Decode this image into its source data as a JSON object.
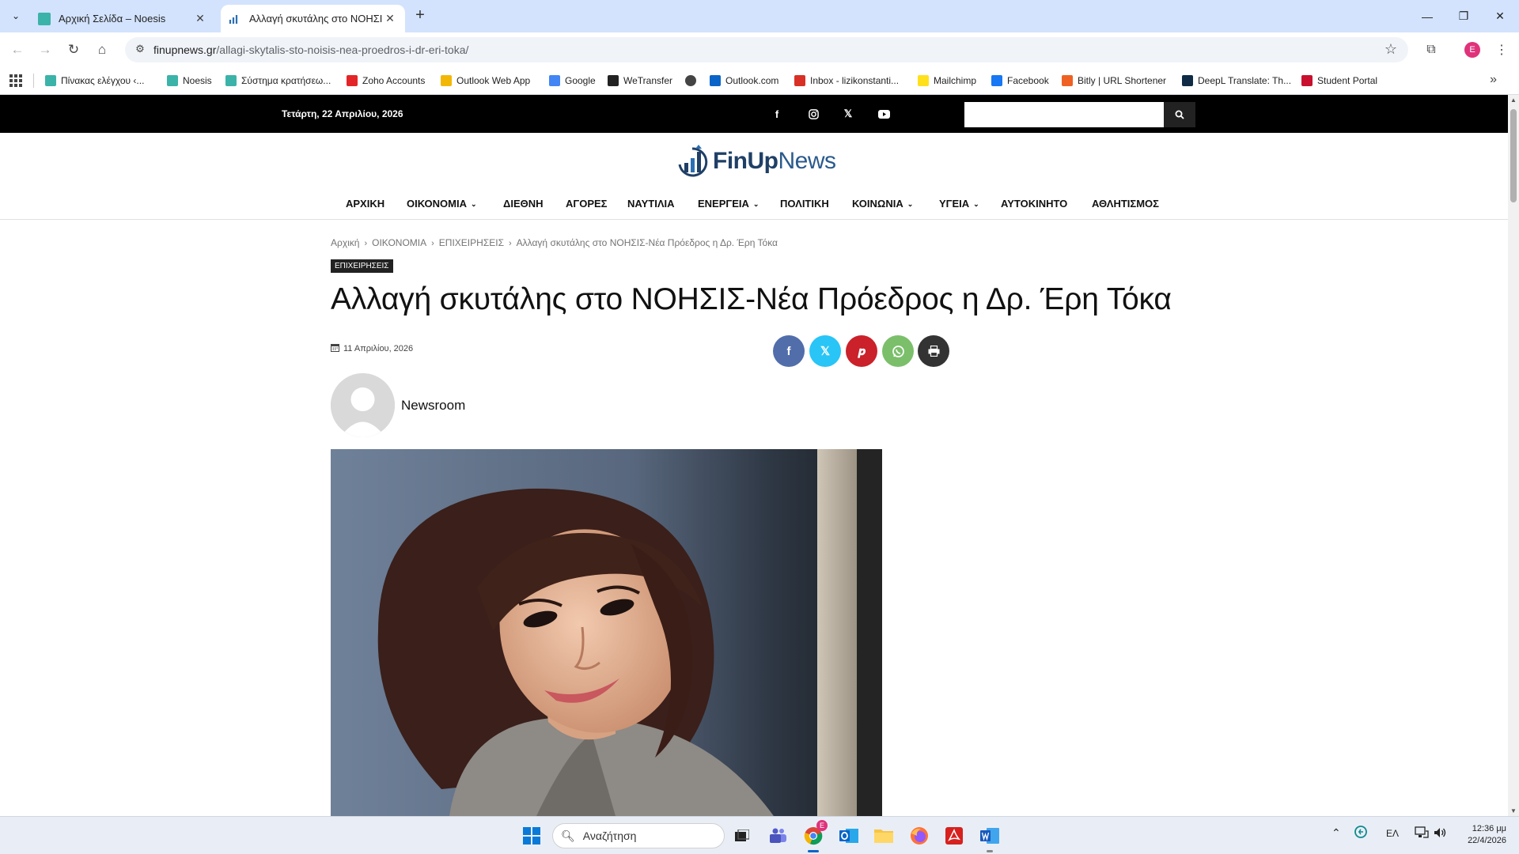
{
  "browser": {
    "tabs": [
      {
        "title": "Αρχική Σελίδα – Noesis",
        "active": false
      },
      {
        "title": "Αλλαγή σκυτάλης στο ΝΟΗΣΙΣ",
        "active": true
      }
    ],
    "url_host": "finupnews.gr",
    "url_path": "/allagi-skytalis-sto-noisis-nea-proedros-i-dr-eri-toka/",
    "profile_initial": "E",
    "bookmarks": [
      {
        "label": "Πίνακας ελέγχου ‹...",
        "icon": "noesis-icon",
        "color": "#3bb3a8"
      },
      {
        "label": "Noesis",
        "icon": "noesis-icon",
        "color": "#3bb3a8"
      },
      {
        "label": "Σύστημα κρατήσεω...",
        "icon": "noesis-icon",
        "color": "#3bb3a8"
      },
      {
        "label": "Zoho Accounts",
        "icon": "zoho-icon",
        "color": "#e42527"
      },
      {
        "label": "Outlook Web App",
        "icon": "outlook-web-icon",
        "color": "#f2b705"
      },
      {
        "label": "Google",
        "icon": "google-icon",
        "color": "#4285f4"
      },
      {
        "label": "WeTransfer",
        "icon": "wetransfer-icon",
        "color": "#222222"
      },
      {
        "label": "",
        "icon": "globe-icon",
        "color": "#444444"
      },
      {
        "label": "Outlook.com",
        "icon": "outlook-icon",
        "color": "#0a64c8"
      },
      {
        "label": "Inbox - lizikonstanti...",
        "icon": "gmail-icon",
        "color": "#d93025"
      },
      {
        "label": "Mailchimp",
        "icon": "mailchimp-icon",
        "color": "#ffe01b"
      },
      {
        "label": "Facebook",
        "icon": "facebook-icon",
        "color": "#1877f2"
      },
      {
        "label": "Bitly | URL Shortener",
        "icon": "bitly-icon",
        "color": "#ee6123"
      },
      {
        "label": "DeepL Translate: Th...",
        "icon": "deepl-icon",
        "color": "#0f2b46"
      },
      {
        "label": "Student Portal",
        "icon": "student-portal-icon",
        "color": "#c8102e"
      }
    ]
  },
  "site": {
    "date": "Τετάρτη, 22 Απριλίου, 2026",
    "logo_fin": "FinUp",
    "logo_news": "News",
    "nav": [
      {
        "label": "ΑΡΧΙΚΗ",
        "dropdown": false
      },
      {
        "label": "ΟΙΚΟΝΟΜΙΑ",
        "dropdown": true
      },
      {
        "label": "ΔΙΕΘΝΗ",
        "dropdown": false
      },
      {
        "label": "ΑΓΟΡΕΣ",
        "dropdown": false
      },
      {
        "label": "ΝΑΥΤΙΛΙΑ",
        "dropdown": false
      },
      {
        "label": "ΕΝΕΡΓΕΙΑ",
        "dropdown": true
      },
      {
        "label": "ΠΟΛΙΤΙΚΗ",
        "dropdown": false
      },
      {
        "label": "ΚΟΙΝΩΝΙΑ",
        "dropdown": true
      },
      {
        "label": "ΥΓΕΙΑ",
        "dropdown": true
      },
      {
        "label": "ΑΥΤΟΚΙΝΗΤΟ",
        "dropdown": false
      },
      {
        "label": "ΑΘΛΗΤΙΣΜΟΣ",
        "dropdown": false
      }
    ]
  },
  "article": {
    "breadcrumb": [
      "Αρχική",
      "ΟΙΚΟΝΟΜΙΑ",
      "ΕΠΙΧΕΙΡΗΣΕΙΣ",
      "Αλλαγή σκυτάλης στο ΝΟΗΣΙΣ-Νέα Πρόεδρος η Δρ. Έρη Τόκα"
    ],
    "category": "ΕΠΙΧΕΙΡΗΣΕΙΣ",
    "title": "Αλλαγή σκυτάλης στο ΝΟΗΣΙΣ-Νέα Πρόεδρος η Δρ. Έρη Τόκα",
    "date": "11 Απριλίου, 2026",
    "author": "Newsroom",
    "share": [
      {
        "name": "facebook",
        "color": "#516eab"
      },
      {
        "name": "x",
        "color": "#29c5f6"
      },
      {
        "name": "pinterest",
        "color": "#ca212a"
      },
      {
        "name": "whatsapp",
        "color": "#7bbf6a"
      },
      {
        "name": "print",
        "color": "#333333"
      }
    ]
  },
  "taskbar": {
    "search_placeholder": "Αναζήτηση",
    "language": "ΕΛ",
    "time": "12:36 μμ",
    "date": "22/4/2026"
  }
}
